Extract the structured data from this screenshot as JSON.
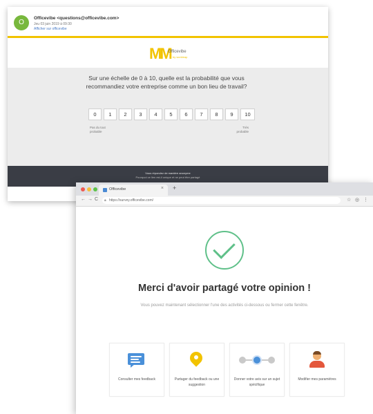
{
  "email": {
    "sender": "Officevibe <questions@officevibe.com>",
    "date": "Jeu 03 juin 2019 à 09:30",
    "link": "Afficher sur officevibe",
    "avatar_letter": "O",
    "logo_word": "Officevibe",
    "logo_sub": "by workleap",
    "question": "Sur une échelle de 0 à 10, quelle est la probabilité que vous recommandiez votre entreprise comme un bon lieu de travail?",
    "scale": [
      "0",
      "1",
      "2",
      "3",
      "4",
      "5",
      "6",
      "7",
      "8",
      "9",
      "10"
    ],
    "low_label": "Pas du tout probable",
    "high_label": "Très probable",
    "footer_line1": "Vous répondez de manière anonyme",
    "footer_line2": "Pourquoi ce lien est-il unique et ne peut être partagé"
  },
  "browser": {
    "tab_title": "Officevibe",
    "tab_close": "×",
    "new_tab": "+",
    "url": "https://survey.officevibe.com/",
    "nav_back": "←",
    "nav_forward": "→",
    "nav_reload": "C",
    "star": "☆",
    "ext": "◎",
    "menu": "⋮"
  },
  "confirmation": {
    "title": "Merci d'avoir partagé votre opinion !",
    "subtitle": "Vous pouvez maintenant sélectionner l'une des activités ci-dessous ou fermer cette fenêtre.",
    "cards": [
      {
        "label": "Consulter mes feedback",
        "icon": "chat-icon"
      },
      {
        "label": "Partager du feedback ou une suggestion",
        "icon": "lightbulb-pin-icon"
      },
      {
        "label": "Donner votre avis sur un sujet spécifique",
        "icon": "progress-steps-icon"
      },
      {
        "label": "Modifier mes paramètres",
        "icon": "person-icon"
      }
    ]
  },
  "colors": {
    "accent_yellow": "#f2c300",
    "success_green": "#5fc089",
    "footer_dark": "#3a3d45",
    "link_blue": "#4a90d9"
  }
}
